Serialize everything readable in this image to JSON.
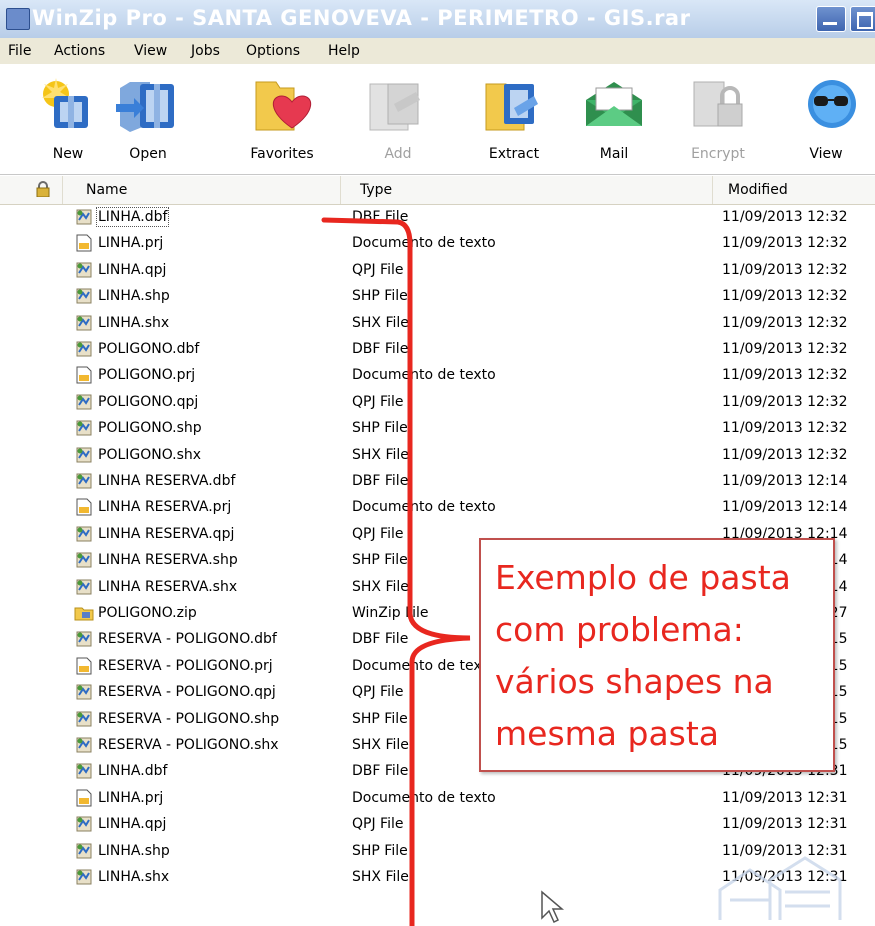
{
  "window": {
    "title": "WinZip Pro - SANTA GENOVEVA - PERIMETRO - GIS.rar"
  },
  "menu": [
    "File",
    "Actions",
    "View",
    "Jobs",
    "Options",
    "Help"
  ],
  "toolbar": [
    {
      "label": "New",
      "icon": "new-archive-icon",
      "enabled": true
    },
    {
      "label": "Open",
      "icon": "open-archive-icon",
      "enabled": true
    },
    {
      "label": "Favorites",
      "icon": "favorites-icon",
      "enabled": true
    },
    {
      "label": "Add",
      "icon": "add-icon",
      "enabled": false
    },
    {
      "label": "Extract",
      "icon": "extract-icon",
      "enabled": true
    },
    {
      "label": "Mail",
      "icon": "mail-icon",
      "enabled": true
    },
    {
      "label": "Encrypt",
      "icon": "encrypt-icon",
      "enabled": false
    },
    {
      "label": "View",
      "icon": "view-icon",
      "enabled": true
    }
  ],
  "columns": {
    "name": "Name",
    "type": "Type",
    "modified": "Modified"
  },
  "files": [
    {
      "name": "LINHA.dbf",
      "type": "DBF File",
      "modified": "11/09/2013 12:32",
      "icon": "shapefile-icon"
    },
    {
      "name": "LINHA.prj",
      "type": "Documento de texto",
      "modified": "11/09/2013 12:32",
      "icon": "text-document-icon"
    },
    {
      "name": "LINHA.qpj",
      "type": "QPJ File",
      "modified": "11/09/2013 12:32",
      "icon": "shapefile-icon"
    },
    {
      "name": "LINHA.shp",
      "type": "SHP File",
      "modified": "11/09/2013 12:32",
      "icon": "shapefile-icon"
    },
    {
      "name": "LINHA.shx",
      "type": "SHX File",
      "modified": "11/09/2013 12:32",
      "icon": "shapefile-icon"
    },
    {
      "name": "POLIGONO.dbf",
      "type": "DBF File",
      "modified": "11/09/2013 12:32",
      "icon": "shapefile-icon"
    },
    {
      "name": "POLIGONO.prj",
      "type": "Documento de texto",
      "modified": "11/09/2013 12:32",
      "icon": "text-document-icon"
    },
    {
      "name": "POLIGONO.qpj",
      "type": "QPJ File",
      "modified": "11/09/2013 12:32",
      "icon": "shapefile-icon"
    },
    {
      "name": "POLIGONO.shp",
      "type": "SHP File",
      "modified": "11/09/2013 12:32",
      "icon": "shapefile-icon"
    },
    {
      "name": "POLIGONO.shx",
      "type": "SHX File",
      "modified": "11/09/2013 12:32",
      "icon": "shapefile-icon"
    },
    {
      "name": "LINHA RESERVA.dbf",
      "type": "DBF File",
      "modified": "11/09/2013 12:14",
      "icon": "shapefile-icon"
    },
    {
      "name": "LINHA RESERVA.prj",
      "type": "Documento de texto",
      "modified": "11/09/2013 12:14",
      "icon": "text-document-icon"
    },
    {
      "name": "LINHA RESERVA.qpj",
      "type": "QPJ File",
      "modified": "11/09/2013 12:14",
      "icon": "shapefile-icon"
    },
    {
      "name": "LINHA RESERVA.shp",
      "type": "SHP File",
      "modified": "11/09/2013 12:14",
      "icon": "shapefile-icon"
    },
    {
      "name": "LINHA RESERVA.shx",
      "type": "SHX File",
      "modified": "11/09/2013 12:14",
      "icon": "shapefile-icon"
    },
    {
      "name": "POLIGONO.zip",
      "type": "WinZip File",
      "modified": "11/09/2013 12:27",
      "icon": "zip-archive-icon"
    },
    {
      "name": "RESERVA - POLIGONO.dbf",
      "type": "DBF File",
      "modified": "11/09/2013 12:15",
      "icon": "shapefile-icon"
    },
    {
      "name": "RESERVA - POLIGONO.prj",
      "type": "Documento de texto",
      "modified": "11/09/2013 12:15",
      "icon": "text-document-icon"
    },
    {
      "name": "RESERVA - POLIGONO.qpj",
      "type": "QPJ File",
      "modified": "11/09/2013 12:15",
      "icon": "shapefile-icon"
    },
    {
      "name": "RESERVA - POLIGONO.shp",
      "type": "SHP File",
      "modified": "11/09/2013 12:15",
      "icon": "shapefile-icon"
    },
    {
      "name": "RESERVA - POLIGONO.shx",
      "type": "SHX File",
      "modified": "11/09/2013 12:15",
      "icon": "shapefile-icon"
    },
    {
      "name": "LINHA.dbf",
      "type": "DBF File",
      "modified": "11/09/2013 12:31",
      "icon": "shapefile-icon"
    },
    {
      "name": "LINHA.prj",
      "type": "Documento de texto",
      "modified": "11/09/2013 12:31",
      "icon": "text-document-icon"
    },
    {
      "name": "LINHA.qpj",
      "type": "QPJ File",
      "modified": "11/09/2013 12:31",
      "icon": "shapefile-icon"
    },
    {
      "name": "LINHA.shp",
      "type": "SHP File",
      "modified": "11/09/2013 12:31",
      "icon": "shapefile-icon"
    },
    {
      "name": "LINHA.shx",
      "type": "SHX File",
      "modified": "11/09/2013 12:31",
      "icon": "shapefile-icon"
    }
  ],
  "annotation": {
    "lines": [
      "Exemplo de pasta",
      "com problema:",
      "vários shapes na",
      "mesma pasta"
    ],
    "color": "#e8271f",
    "border_color": "#c0504d"
  }
}
